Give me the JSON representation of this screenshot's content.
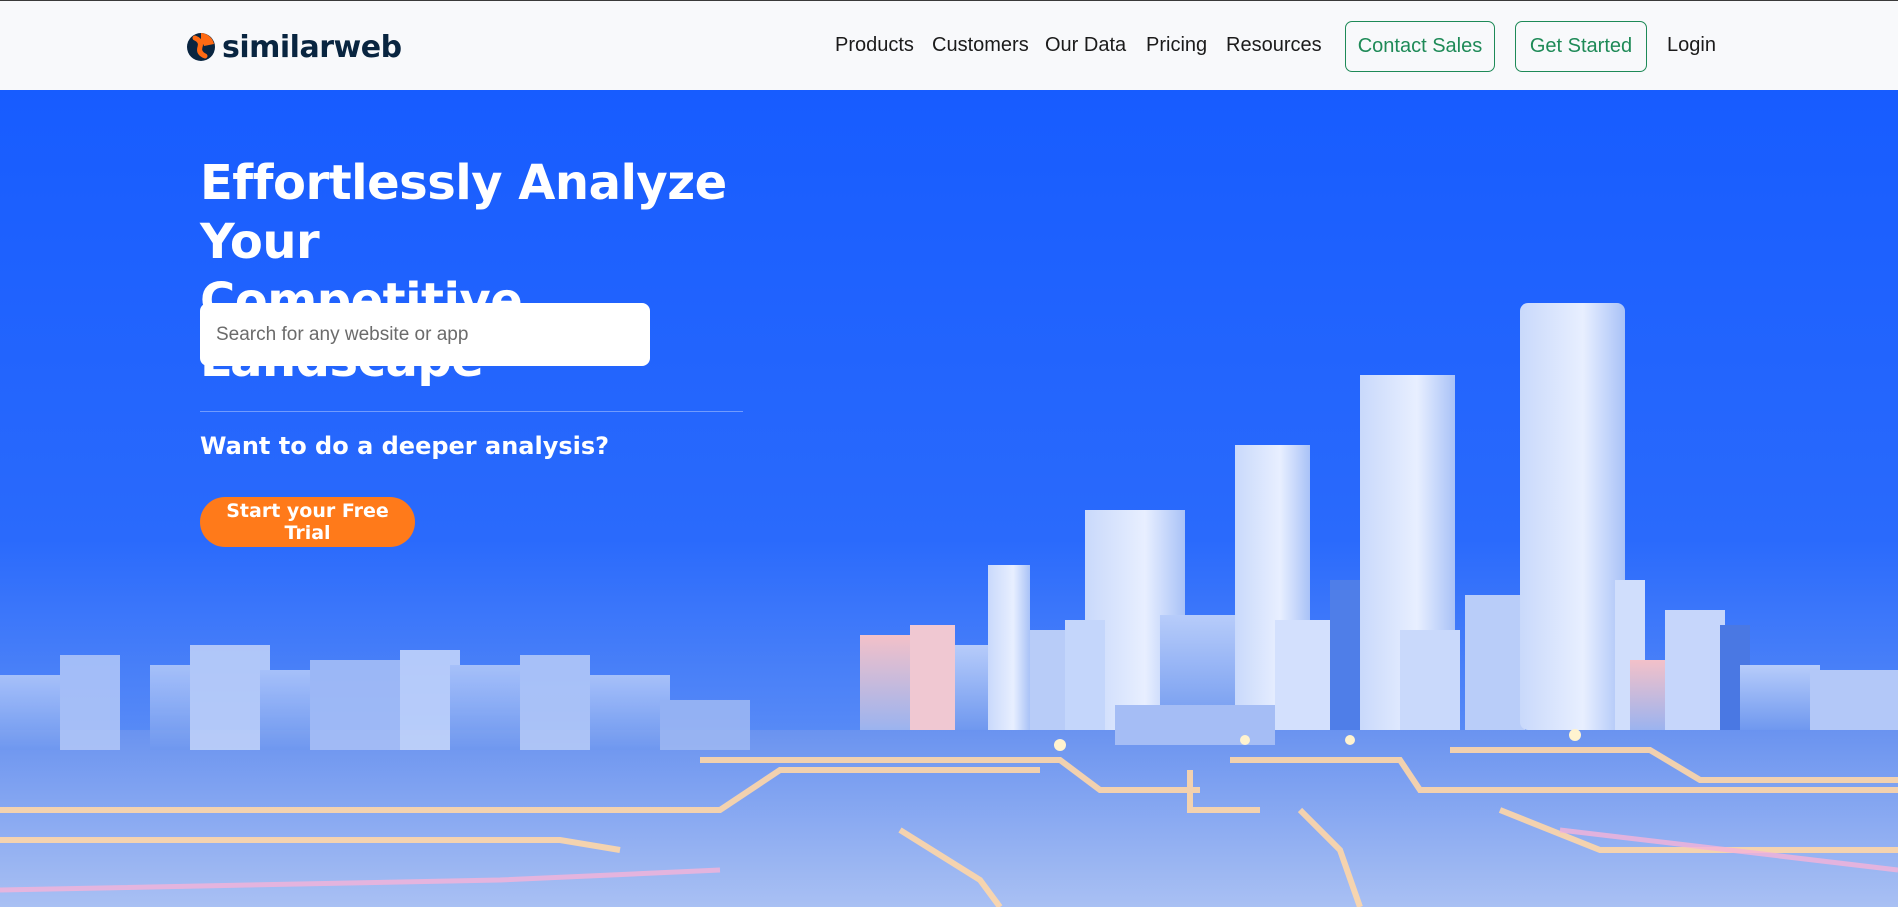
{
  "brand": {
    "name": "similarweb",
    "accent": "#1a5ffe",
    "cta_color": "#ff7a1a",
    "nav_button_color": "#1e8a57"
  },
  "nav": {
    "items": [
      "Products",
      "Customers",
      "Our Data",
      "Pricing",
      "Resources"
    ],
    "contact_sales": "Contact Sales",
    "get_started": "Get Started",
    "login": "Login"
  },
  "hero": {
    "headline_line1": "Effortlessly Analyze Your",
    "headline_line2": "Competitive Landscape",
    "search_placeholder": "Search for any website or app",
    "deeper_text": "Want to do a deeper analysis?",
    "cta_label": "Start your Free Trial",
    "background_image": "city-skyline-illustration"
  }
}
